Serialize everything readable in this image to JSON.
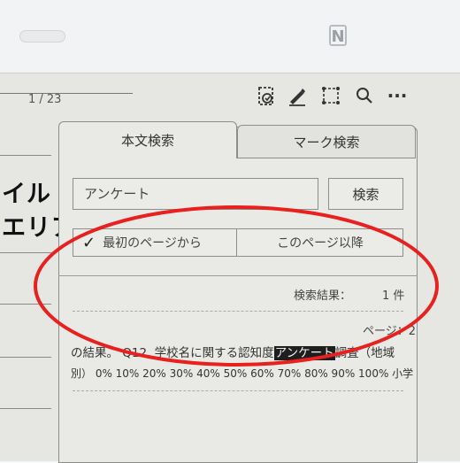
{
  "toolbar": {
    "page_indicator": "1 / 23",
    "icons": [
      "jump-icon",
      "pen-icon",
      "select-icon",
      "search-icon",
      "more-icon"
    ],
    "more_label": "···"
  },
  "document": {
    "title_line1": "イル",
    "title_line2": "エリア"
  },
  "search_panel": {
    "tabs": [
      {
        "label": "本文検索",
        "active": true
      },
      {
        "label": "マーク検索",
        "active": false
      }
    ],
    "input_value": "アンケート",
    "search_button": "検索",
    "scope_options": [
      {
        "label": "最初のページから",
        "checked": true,
        "check_mark": "✓"
      },
      {
        "label": "このページ以降",
        "checked": false
      }
    ],
    "results_label": "検索結果：",
    "results_count": "1 件",
    "result": {
      "page": "ページ：2",
      "line1_before": "の結果。 Q12. 学校名に関する認知度",
      "line1_highlight": "アンケート",
      "line1_after": "調査（地域",
      "line2": "別） 0% 10% 20% 30% 40% 50% 60% 70% 80% 90% 100% 小学"
    }
  },
  "colors": {
    "annotation_ellipse": "#e8201e",
    "highlight_bg": "#1e1e1e"
  }
}
